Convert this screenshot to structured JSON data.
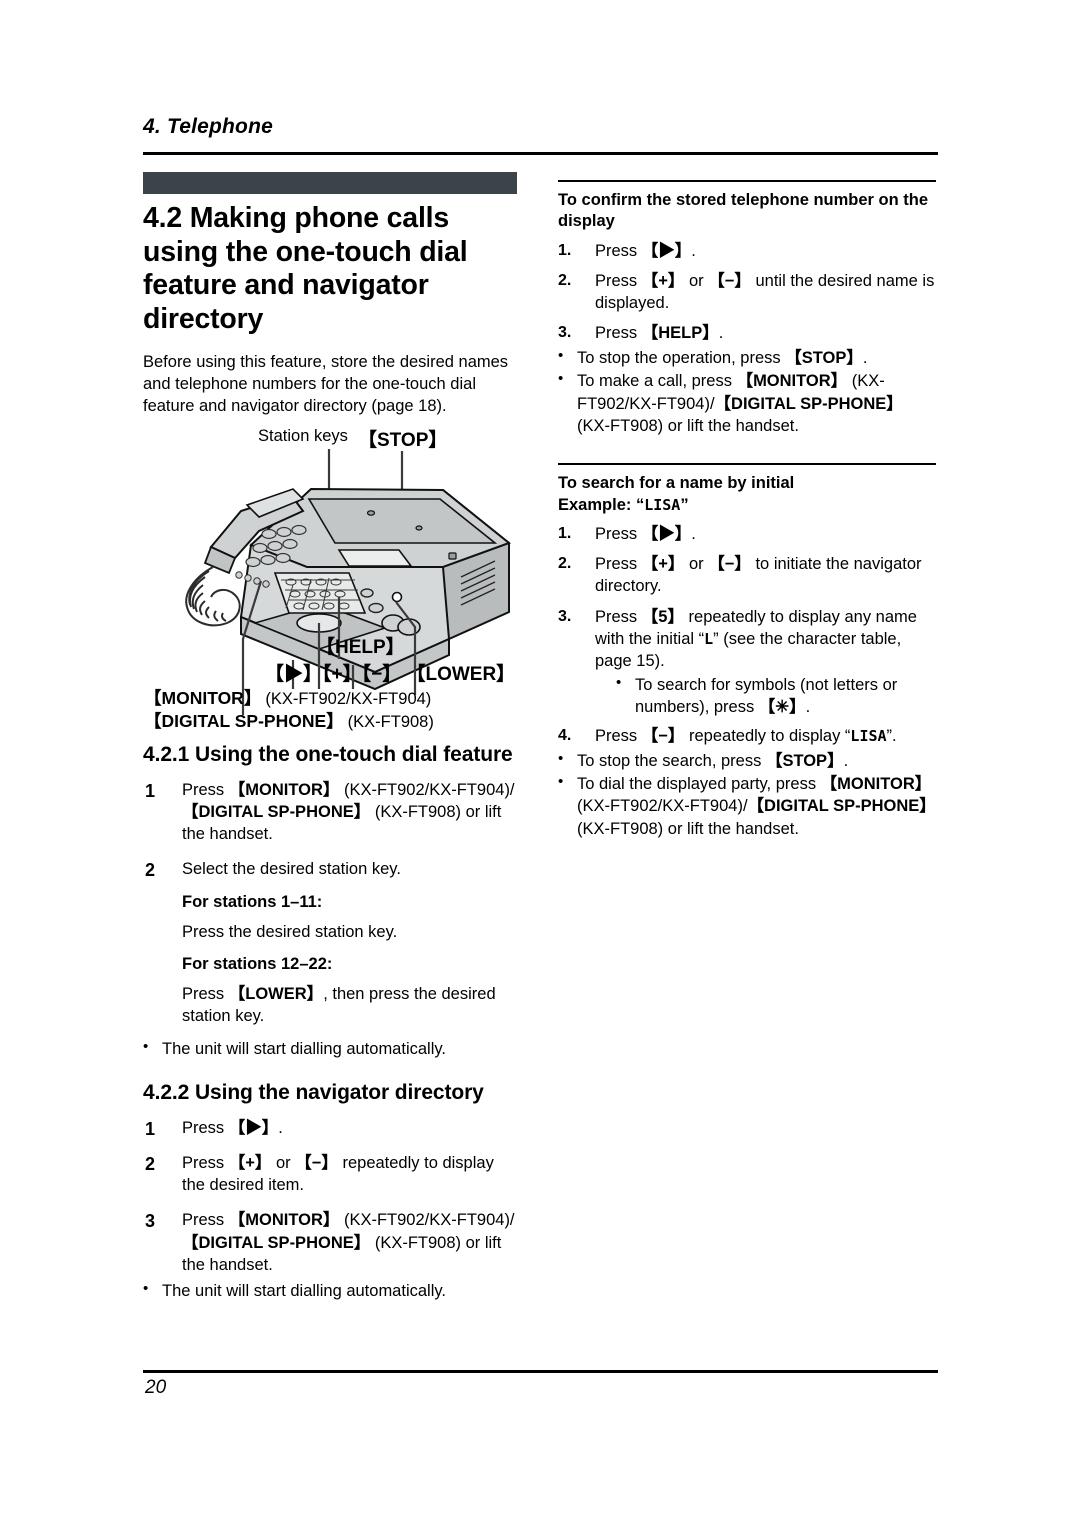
{
  "document": {
    "running_head": "4. Telephone",
    "page_number": "20",
    "banner_color": "#3b4449"
  },
  "left_column": {
    "section_heading": "4.2 Making phone calls using the one-touch dial feature and navigator directory",
    "intro_paragraph": "Before using this feature, store the desired names and telephone numbers for the one-touch dial feature and navigator directory (page 18).",
    "illustration": {
      "name": "fax-machine-diagram",
      "callouts": {
        "station_keys": "Station keys",
        "stop": "【STOP】",
        "help": "【HELP】",
        "nav_keys": "【",
        "nav_keys_full": "【▶】【+】【−】  【LOWER】",
        "lower": "【LOWER】",
        "monitor_line": "【MONITOR】 (KX-FT902/KX-FT904)",
        "monitor_key": "【MONITOR】",
        "monitor_models": "(KX-FT902/KX-FT904)",
        "digital_line": "【DIGITAL SP-PHONE】 (KX-FT908)",
        "digital_key": "【DIGITAL SP-PHONE】",
        "digital_models": "(KX-FT908)"
      }
    },
    "subsection_1": {
      "heading": "4.2.1 Using the one-touch dial feature",
      "steps": [
        {
          "num": "1",
          "text_pre": "Press ",
          "key1": "【MONITOR】",
          "mid1": " (KX-FT902/KX-FT904)/",
          "key2": "【DIGITAL SP-PHONE】",
          "mid2": " (KX-FT908) or lift the handset."
        },
        {
          "num": "2",
          "text_pre": "Select the desired station key.",
          "key1": "",
          "mid1": "",
          "key2": "",
          "mid2": ""
        }
      ],
      "stations_1_11_heading": "For stations 1–11:",
      "stations_1_11_body": "Press the desired station key.",
      "stations_12_22_heading": "For stations 12–22:",
      "stations_12_22_pre": "Press ",
      "stations_12_22_key": "【LOWER】",
      "stations_12_22_post": ", then press the desired station key.",
      "auto_dial_bullet": "The unit will start dialling automatically."
    },
    "subsection_2": {
      "heading": "4.2.2 Using the navigator directory",
      "step1_pre": "Press ",
      "step1_key": "【▶】",
      "step1_post": ".",
      "step2_pre": "Press ",
      "step2_key_a": "【+】",
      "step2_mid": " or ",
      "step2_key_b": "【−】",
      "step2_post": " repeatedly to display the desired item.",
      "step3_pre": "Press ",
      "step3_key1": "【MONITOR】",
      "step3_mid1": " (KX-FT902/KX-FT904)/",
      "step3_key2": "【DIGITAL SP-PHONE】",
      "step3_mid2": " (KX-FT908) or lift the handset.",
      "auto_dial_bullet": "The unit will start dialling automatically."
    }
  },
  "right_column": {
    "block_confirm": {
      "heading": "To confirm the stored telephone number on the display",
      "step1_num": "1.",
      "step1_pre": "Press ",
      "step1_key": "【▶】",
      "step1_post": ".",
      "step2_num": "2.",
      "step2_pre": "Press ",
      "step2_key_a": "【+】",
      "step2_mid": " or ",
      "step2_key_b": "【−】",
      "step2_post": " until the desired name is displayed.",
      "step3_num": "3.",
      "step3_pre": "Press ",
      "step3_key": "【HELP】",
      "step3_post": ".",
      "bullet1_pre": "To stop the operation, press ",
      "bullet1_key": "【STOP】",
      "bullet1_post": ".",
      "bullet2_pre": "To make a call, press ",
      "bullet2_key1": "【MONITOR】",
      "bullet2_mid1": " (KX-FT902/KX-FT904)/",
      "bullet2_key2": "【DIGITAL SP-PHONE】",
      "bullet2_mid2": " (KX-FT908) or lift the handset."
    },
    "block_search": {
      "heading": "To search for a name by initial",
      "example_label": "Example: “",
      "example_value": "LISA",
      "example_close": "”",
      "step1_num": "1.",
      "step1_pre": "Press ",
      "step1_key": "【▶】",
      "step1_post": ".",
      "step2_num": "2.",
      "step2_pre": "Press ",
      "step2_key_a": "【+】",
      "step2_mid": " or ",
      "step2_key_b": "【−】",
      "step2_post": " to initiate the navigator directory.",
      "step3_num": "3.",
      "step3_pre": "Press ",
      "step3_key": "【5】",
      "step3_mid": " repeatedly to display any name with the initial “",
      "step3_initial": "L",
      "step3_post": "” (see the character table, page 15).",
      "step3_bullet_pre": "To search for symbols (not letters or numbers), press ",
      "step3_bullet_key": "【✳】",
      "step3_bullet_post": ".",
      "step4_num": "4.",
      "step4_pre": "Press ",
      "step4_key": "【−】",
      "step4_mid": " repeatedly to display “",
      "step4_value": "LISA",
      "step4_post": "”.",
      "bullet1_pre": "To stop the search, press ",
      "bullet1_key": "【STOP】",
      "bullet1_post": ".",
      "bullet2_pre": "To dial the displayed party, press ",
      "bullet2_key1": "【MONITOR】",
      "bullet2_mid1": " (KX-FT902/KX-FT904)/",
      "bullet2_key2": "【DIGITAL SP-PHONE】",
      "bullet2_mid2": " (KX-FT908) or lift the handset."
    }
  }
}
